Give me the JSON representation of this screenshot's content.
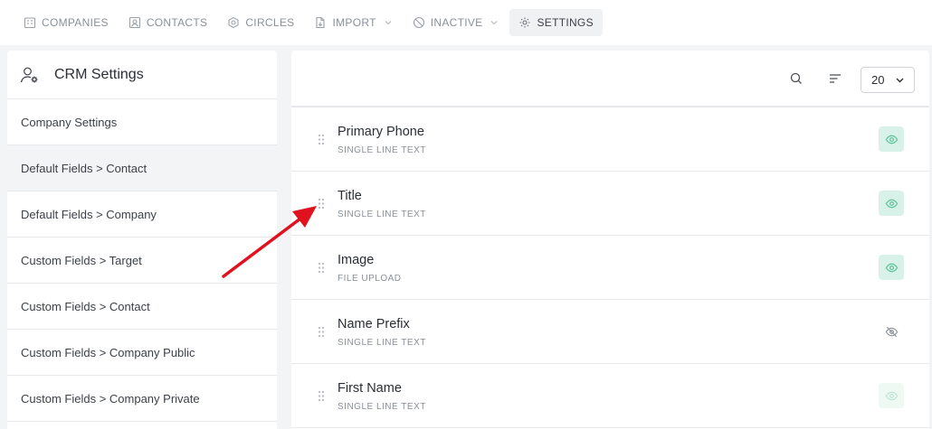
{
  "topnav": {
    "items": [
      {
        "label": "COMPANIES",
        "icon": "building-icon"
      },
      {
        "label": "CONTACTS",
        "icon": "contact-card-icon"
      },
      {
        "label": "CIRCLES",
        "icon": "circles-icon"
      },
      {
        "label": "IMPORT",
        "icon": "import-file-icon"
      },
      {
        "label": "INACTIVE",
        "icon": "ban-icon"
      },
      {
        "label": "SETTINGS",
        "icon": "gear-icon"
      }
    ]
  },
  "sidebar": {
    "title": "CRM Settings",
    "items": [
      {
        "label": "Company Settings"
      },
      {
        "label": "Default Fields > Contact"
      },
      {
        "label": "Default Fields > Company"
      },
      {
        "label": "Custom Fields > Target"
      },
      {
        "label": "Custom Fields > Contact"
      },
      {
        "label": "Custom Fields > Company Public"
      },
      {
        "label": "Custom Fields > Company Private"
      }
    ]
  },
  "toolbar": {
    "per_page": "20"
  },
  "fields": [
    {
      "name": "Primary Phone",
      "type": "SINGLE LINE TEXT",
      "visibility": "visible"
    },
    {
      "name": "Title",
      "type": "SINGLE LINE TEXT",
      "visibility": "visible"
    },
    {
      "name": "Image",
      "type": "FILE UPLOAD",
      "visibility": "visible"
    },
    {
      "name": "Name Prefix",
      "type": "SINGLE LINE TEXT",
      "visibility": "hidden"
    },
    {
      "name": "First Name",
      "type": "SINGLE LINE TEXT",
      "visibility": "visible-disabled"
    }
  ],
  "colors": {
    "accent_green": "#5cc49a",
    "annotation_red": "#e0121f"
  }
}
